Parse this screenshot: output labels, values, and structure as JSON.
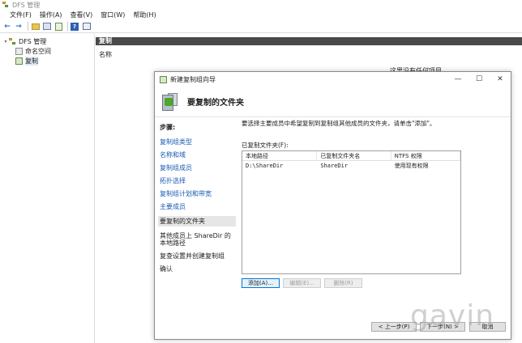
{
  "window": {
    "title": "DFS 管理"
  },
  "menu": [
    "文件(F)",
    "操作(A)",
    "查看(V)",
    "窗口(W)",
    "帮助(H)"
  ],
  "tree": {
    "root": "DFS 管理",
    "children": [
      "命名空间",
      "复制"
    ]
  },
  "right_pane": {
    "header": "复制",
    "column": "名称",
    "empty_text": "这里没有任何项目。"
  },
  "dialog": {
    "title": "新建复制组向导",
    "heading": "要复制的文件夹",
    "steps_title": "步骤:",
    "steps": [
      "复制组类型",
      "名称和域",
      "复制组成员",
      "拓扑选择",
      "复制组计划和带宽",
      "主要成员",
      "要复制的文件夹",
      "其他成员上 ShareDir 的本地路径",
      "复查设置并创建复制组",
      "确认"
    ],
    "current_step_index": 6,
    "instruction": "要选择主要成员中希望复制到复制组其他成员的文件夹，请单击\"添加\"。",
    "folders_label": "已复制文件夹(F):",
    "columns": [
      "本地路径",
      "已复制文件夹名",
      "NTFS 权限"
    ],
    "rows": [
      [
        "D:\\ShareDir",
        "ShareDir",
        "使用现有权限"
      ]
    ],
    "buttons": {
      "add": "添加(A)...",
      "edit": "编辑(E)...",
      "remove": "删除(R)",
      "prev": "< 上一步(P)",
      "next": "下一步(N) >",
      "cancel": "取消"
    }
  },
  "watermark": "gavin"
}
